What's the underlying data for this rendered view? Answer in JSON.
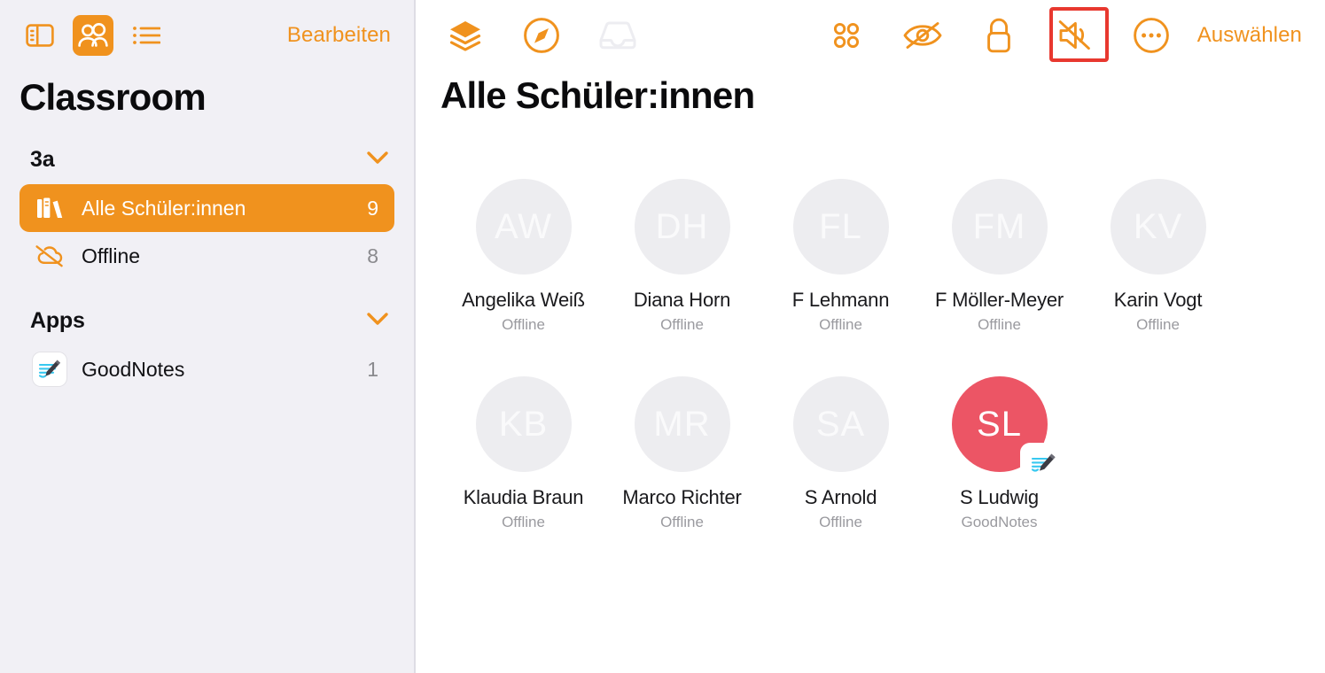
{
  "sidebar": {
    "toolbar": {
      "icons": [
        {
          "name": "sidebar-toggle-icon",
          "label": "Seitenleiste"
        },
        {
          "name": "people-icon",
          "label": "Schüler:innen"
        },
        {
          "name": "list-icon",
          "label": "Liste"
        }
      ],
      "edit_label": "Bearbeiten"
    },
    "title": "Classroom",
    "sections": [
      {
        "id": "class",
        "label": "3a",
        "expanded": true,
        "rows": [
          {
            "icon": "books-icon",
            "label": "Alle Schüler:innen",
            "count": "9",
            "selected": true
          },
          {
            "icon": "cloud-slash-icon",
            "label": "Offline",
            "count": "8",
            "selected": false
          }
        ]
      },
      {
        "id": "apps",
        "label": "Apps",
        "expanded": true,
        "rows": [
          {
            "icon": "goodnotes-app-icon",
            "label": "GoodNotes",
            "count": "1",
            "selected": false
          }
        ]
      }
    ]
  },
  "main": {
    "toolbar": {
      "left_icons": [
        {
          "name": "layers-icon",
          "state": "enabled",
          "color": "#F0921E"
        },
        {
          "name": "navigate-compass-icon",
          "state": "enabled",
          "color": "#F0921E"
        },
        {
          "name": "inbox-tray-icon",
          "state": "disabled",
          "color": "#EEEEF1"
        }
      ],
      "right_icons": [
        {
          "name": "grid-apps-icon",
          "state": "enabled",
          "color": "#F0921E",
          "highlighted": false
        },
        {
          "name": "eye-slash-icon",
          "state": "enabled",
          "color": "#F0921E",
          "highlighted": false
        },
        {
          "name": "lock-icon",
          "state": "enabled",
          "color": "#F0921E",
          "highlighted": false
        },
        {
          "name": "speaker-mute-icon",
          "state": "enabled",
          "color": "#F0921E",
          "highlighted": true
        },
        {
          "name": "more-ellipsis-icon",
          "state": "enabled",
          "color": "#F0921E",
          "highlighted": false
        }
      ],
      "select_label": "Auswählen",
      "highlight_color": "#E8382F"
    },
    "title": "Alle Schüler:innen",
    "students": [
      {
        "initials": "AW",
        "name": "Angelika Weiß",
        "status": "Offline",
        "active": false,
        "badge": null
      },
      {
        "initials": "DH",
        "name": "Diana Horn",
        "status": "Offline",
        "active": false,
        "badge": null
      },
      {
        "initials": "FL",
        "name": "F Lehmann",
        "status": "Offline",
        "active": false,
        "badge": null
      },
      {
        "initials": "FM",
        "name": "F Möller-Meyer",
        "status": "Offline",
        "active": false,
        "badge": null
      },
      {
        "initials": "KV",
        "name": "Karin Vogt",
        "status": "Offline",
        "active": false,
        "badge": null
      },
      {
        "initials": "KB",
        "name": "Klaudia Braun",
        "status": "Offline",
        "active": false,
        "badge": null
      },
      {
        "initials": "MR",
        "name": "Marco Richter",
        "status": "Offline",
        "active": false,
        "badge": null
      },
      {
        "initials": "SA",
        "name": "S Arnold",
        "status": "Offline",
        "active": false,
        "badge": null
      },
      {
        "initials": "SL",
        "name": "S Ludwig",
        "status": "GoodNotes",
        "active": true,
        "badge": "goodnotes-app-icon"
      }
    ]
  },
  "accent_color": "#F0921E",
  "avatar_active_color": "#EC5565"
}
